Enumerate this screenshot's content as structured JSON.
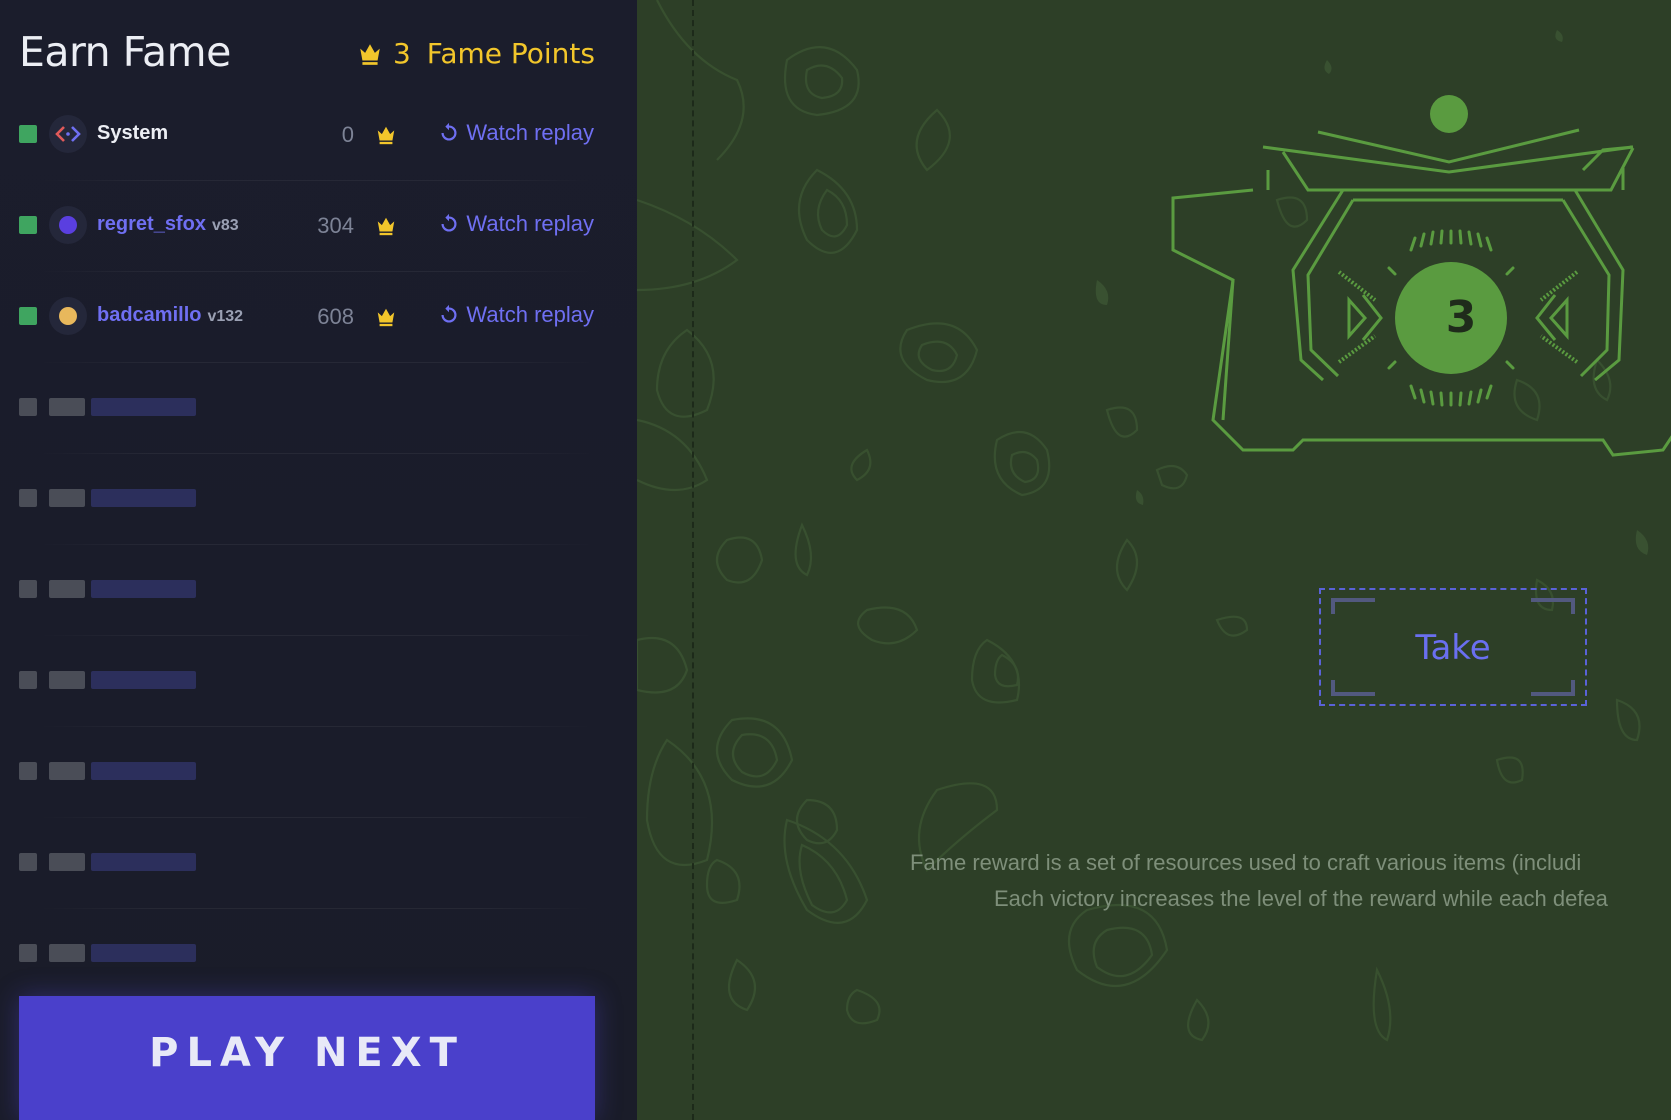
{
  "header": {
    "title": "Earn Fame",
    "fame_points_count": "3",
    "fame_points_label": "Fame Points"
  },
  "matches": [
    {
      "name": "System",
      "version": "",
      "score": "0",
      "replay_label": "Watch replay",
      "avatar_color": "#6f6ff2",
      "avatar_icon": "code-icon"
    },
    {
      "name": "regret_sfox",
      "version": "v83",
      "score": "304",
      "replay_label": "Watch replay",
      "avatar_color": "#5a3fe0"
    },
    {
      "name": "badcamillo",
      "version": "v132",
      "score": "608",
      "replay_label": "Watch replay",
      "avatar_color": "#e8b85c"
    }
  ],
  "placeholder_rows": 7,
  "play_button": {
    "label": "PLAY NEXT"
  },
  "reward": {
    "level": "3",
    "take_label": "Take",
    "description_line1": "Fame reward is a set of resources used to craft various items (includi",
    "description_line2": "Each victory increases the level of the reward while each defea"
  },
  "colors": {
    "accent": "#6f6ff2",
    "gold": "#f2c62b",
    "status_win": "#3fa560",
    "play_button_bg": "#4a40cb",
    "reward_green": "#5a9b40"
  }
}
